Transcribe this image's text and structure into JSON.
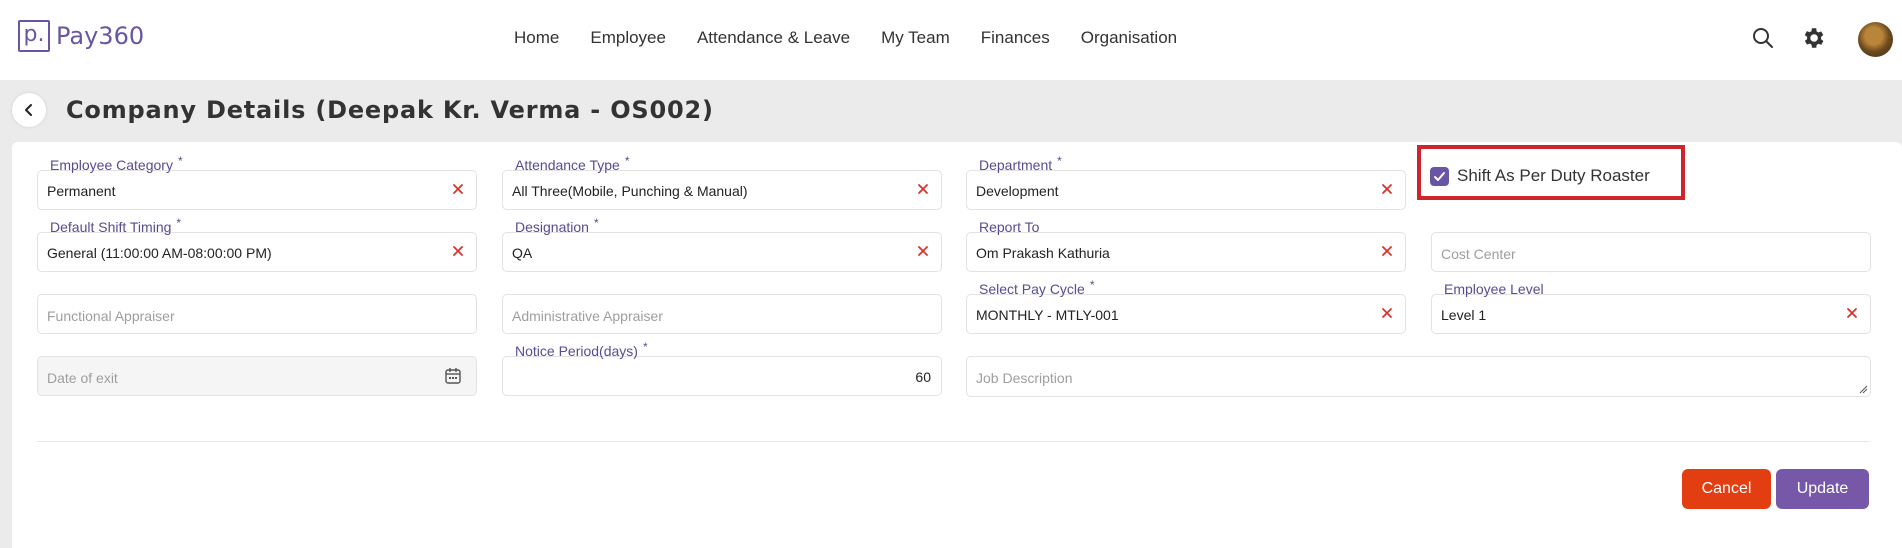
{
  "app": {
    "logo_letter": "p.",
    "logo_text": "Pay360"
  },
  "nav": {
    "items": [
      "Home",
      "Employee",
      "Attendance & Leave",
      "My Team",
      "Finances",
      "Organisation"
    ]
  },
  "header": {
    "title": "Company Details (Deepak Kr. Verma - OS002)"
  },
  "form": {
    "employee_category": {
      "label": "Employee Category",
      "req": "*",
      "value": "Permanent"
    },
    "attendance_type": {
      "label": "Attendance Type",
      "req": "*",
      "value": "All Three(Mobile, Punching & Manual)"
    },
    "department": {
      "label": "Department",
      "req": "*",
      "value": "Development"
    },
    "shift_roaster": {
      "label": "Shift As Per Duty Roaster",
      "checked": true
    },
    "default_shift": {
      "label": "Default Shift Timing",
      "req": "*",
      "value": "General (11:00:00 AM-08:00:00 PM)"
    },
    "designation": {
      "label": "Designation",
      "req": "*",
      "value": "QA"
    },
    "report_to": {
      "label": "Report To",
      "value": "Om Prakash Kathuria"
    },
    "cost_center": {
      "placeholder": "Cost Center"
    },
    "functional_appraiser": {
      "placeholder": "Functional Appraiser"
    },
    "administrative_appraiser": {
      "placeholder": "Administrative Appraiser"
    },
    "pay_cycle": {
      "label": "Select Pay Cycle",
      "req": "*",
      "value": "MONTHLY - MTLY-001"
    },
    "employee_level": {
      "label": "Employee Level",
      "value": "Level 1"
    },
    "date_of_exit": {
      "placeholder": "Date of exit"
    },
    "notice_period": {
      "label": "Notice Period(days)",
      "req": "*",
      "value": "60"
    },
    "job_description": {
      "placeholder": "Job Description"
    }
  },
  "actions": {
    "cancel": "Cancel",
    "update": "Update"
  },
  "colors": {
    "brand": "#6a55a5",
    "cancel": "#e33d12",
    "update": "#7758a8",
    "highlight": "#d0242c",
    "clear_x": "#d9342b"
  }
}
